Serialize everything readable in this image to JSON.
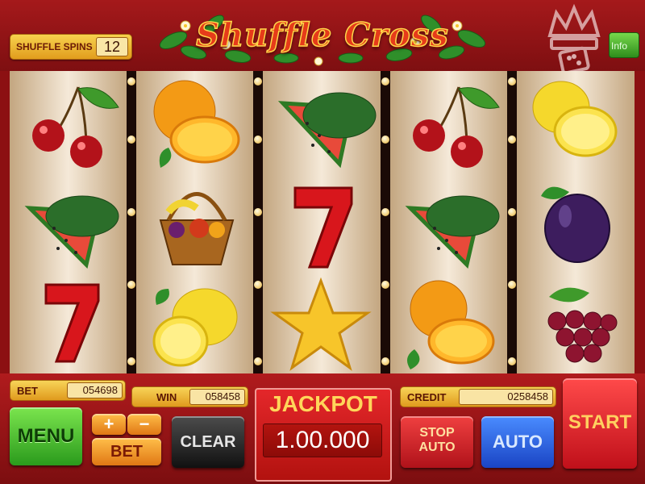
{
  "game": {
    "title": "Shuffle Cross",
    "shuffle_spins_label": "SHUFFLE SPINS",
    "shuffle_spins_value": "12",
    "info_label": "Info"
  },
  "reels": [
    [
      "cherry",
      "watermelon",
      "seven"
    ],
    [
      "orange",
      "fruit-basket",
      "lemon"
    ],
    [
      "watermelon",
      "seven",
      "star"
    ],
    [
      "cherry",
      "watermelon",
      "orange"
    ],
    [
      "lemon",
      "plum",
      "grapes"
    ]
  ],
  "panel": {
    "bet_label": "BET",
    "bet_value": "054698",
    "win_label": "WIN",
    "win_value": "058458",
    "jackpot_label": "JACKPOT",
    "jackpot_value": "1.00.000",
    "credit_label": "CREDIT",
    "credit_value": "0258458",
    "menu_label": "MENU",
    "plus_label": "+",
    "minus_label": "−",
    "bet_button_label": "BET",
    "clear_label": "CLEAR",
    "stop_auto_line1": "STOP",
    "stop_auto_line2": "AUTO",
    "auto_label": "AUTO",
    "start_label": "START"
  },
  "colors": {
    "frame": "#9e1416",
    "menu_button": "#3fb52a",
    "clear_button": "#2a2a2a",
    "auto_button": "#1f5fe0",
    "start_button": "#e01e22",
    "gold": "#f3c744"
  }
}
